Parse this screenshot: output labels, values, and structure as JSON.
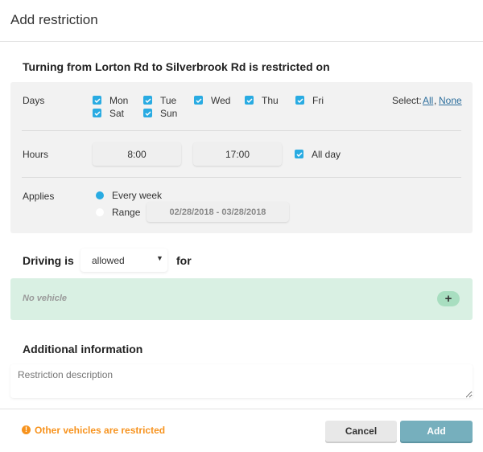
{
  "dialog": {
    "title": "Add restriction",
    "heading": "Turning from Lorton Rd to Silverbrook Rd is restricted on"
  },
  "days": {
    "label": "Days",
    "items": [
      {
        "label": "Mon",
        "checked": true
      },
      {
        "label": "Tue",
        "checked": true
      },
      {
        "label": "Wed",
        "checked": true
      },
      {
        "label": "Thu",
        "checked": true
      },
      {
        "label": "Fri",
        "checked": true
      },
      {
        "label": "Sat",
        "checked": true
      },
      {
        "label": "Sun",
        "checked": true
      }
    ],
    "select_label": "Select:",
    "select_all": "All",
    "comma": ",",
    "select_none": "None"
  },
  "hours": {
    "label": "Hours",
    "from": "8:00",
    "to": "17:00",
    "all_day_label": "All day",
    "all_day_checked": true
  },
  "applies": {
    "label": "Applies",
    "every_week": "Every week",
    "range": "Range",
    "selected": "every_week",
    "range_value": "02/28/2018 - 03/28/2018"
  },
  "driving": {
    "label": "Driving is",
    "value": "allowed",
    "suffix": "for"
  },
  "vehicles": {
    "empty_text": "No vehicle"
  },
  "additional": {
    "heading": "Additional information",
    "placeholder": "Restriction description"
  },
  "footer": {
    "warning": "Other vehicles are restricted",
    "cancel": "Cancel",
    "add": "Add"
  },
  "colors": {
    "accent": "#29abe2",
    "warning": "#f7931e",
    "vehicle_bg": "#d9f0e3",
    "add_button": "#76afbd"
  }
}
